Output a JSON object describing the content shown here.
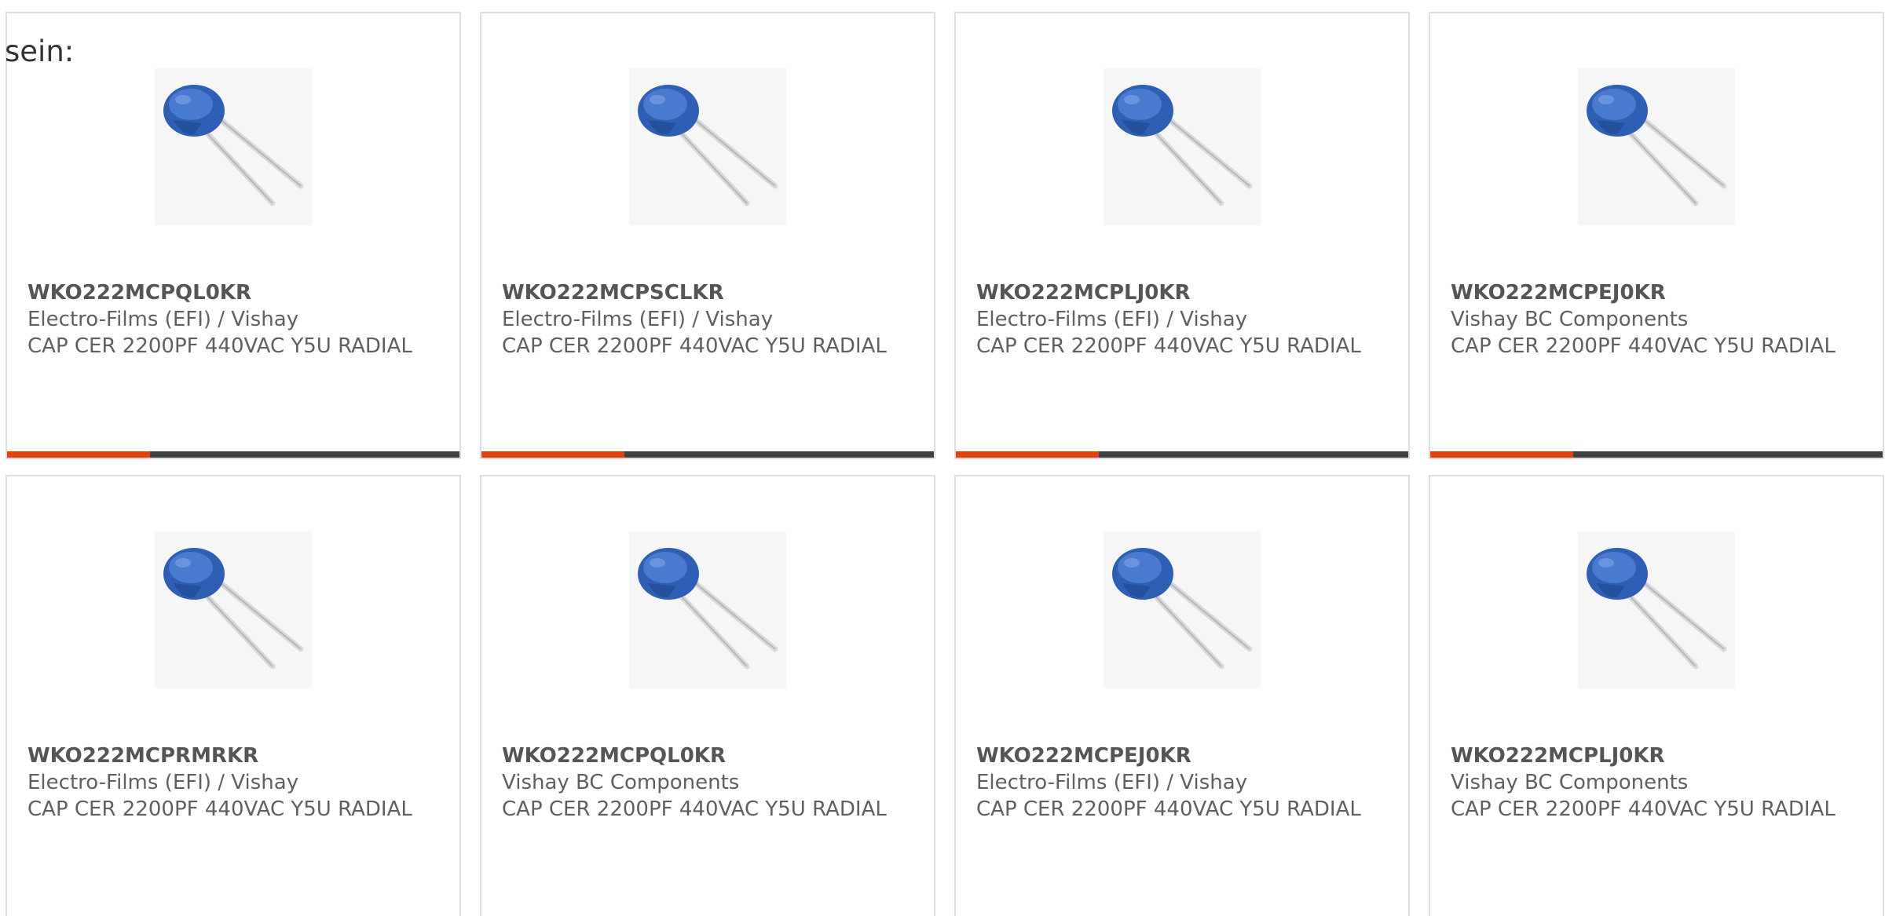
{
  "intro": {
    "text": "sein:"
  },
  "colors": {
    "accent": "#e4400e",
    "bar": "#404040",
    "text": "#5f5f5f",
    "border": "#dddddd"
  },
  "products": [
    {
      "part_number": "WKO222MCPQL0KR",
      "manufacturer": "Electro-Films (EFI) / Vishay",
      "description": "CAP CER 2200PF 440VAC Y5U RADIAL",
      "image": "blue-ceramic-disc-capacitor"
    },
    {
      "part_number": "WKO222MCPSCLKR",
      "manufacturer": "Electro-Films (EFI) / Vishay",
      "description": "CAP CER 2200PF 440VAC Y5U RADIAL",
      "image": "blue-ceramic-disc-capacitor"
    },
    {
      "part_number": "WKO222MCPLJ0KR",
      "manufacturer": "Electro-Films (EFI) / Vishay",
      "description": "CAP CER 2200PF 440VAC Y5U RADIAL",
      "image": "blue-ceramic-disc-capacitor"
    },
    {
      "part_number": "WKO222MCPEJ0KR",
      "manufacturer": "Vishay BC Components",
      "description": "CAP CER 2200PF 440VAC Y5U RADIAL",
      "image": "blue-ceramic-disc-capacitor"
    },
    {
      "part_number": "WKO222MCPRMRKR",
      "manufacturer": "Electro-Films (EFI) / Vishay",
      "description": "CAP CER 2200PF 440VAC Y5U RADIAL",
      "image": "blue-ceramic-disc-capacitor"
    },
    {
      "part_number": "WKO222MCPQL0KR",
      "manufacturer": "Vishay BC Components",
      "description": "CAP CER 2200PF 440VAC Y5U RADIAL",
      "image": "blue-ceramic-disc-capacitor"
    },
    {
      "part_number": "WKO222MCPEJ0KR",
      "manufacturer": "Electro-Films (EFI) / Vishay",
      "description": "CAP CER 2200PF 440VAC Y5U RADIAL",
      "image": "blue-ceramic-disc-capacitor"
    },
    {
      "part_number": "WKO222MCPLJ0KR",
      "manufacturer": "Vishay BC Components",
      "description": "CAP CER 2200PF 440VAC Y5U RADIAL",
      "image": "blue-ceramic-disc-capacitor"
    }
  ]
}
